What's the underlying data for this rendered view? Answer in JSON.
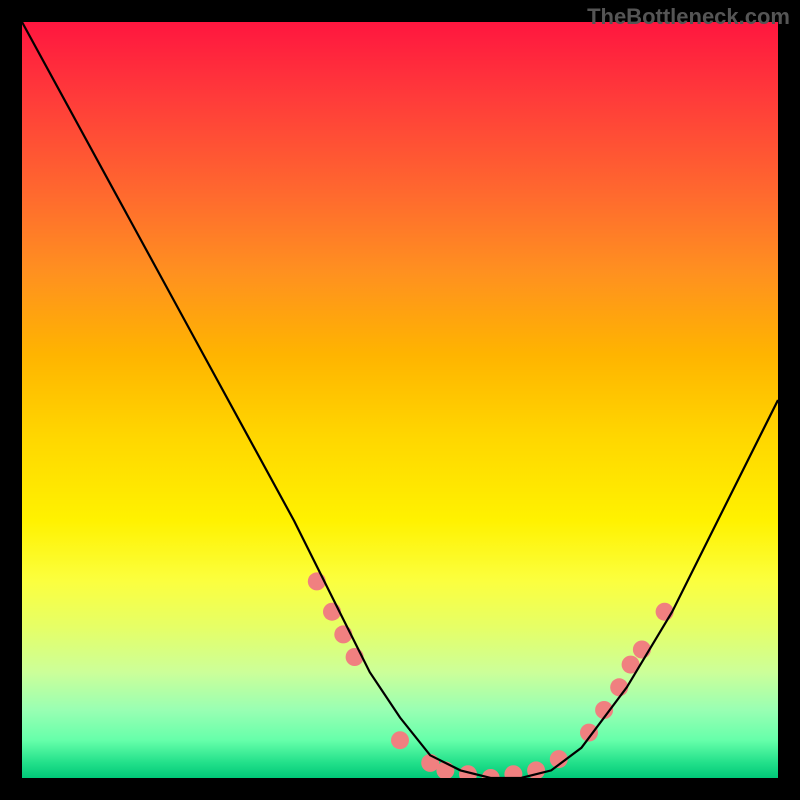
{
  "watermark": "TheBottleneck.com",
  "chart_data": {
    "type": "line",
    "title": "",
    "xlabel": "",
    "ylabel": "",
    "xlim": [
      0,
      100
    ],
    "ylim": [
      0,
      100
    ],
    "grid": false,
    "series": [
      {
        "name": "curve",
        "color": "#000000",
        "x": [
          0,
          6,
          12,
          18,
          24,
          30,
          36,
          42,
          46,
          50,
          54,
          58,
          62,
          66,
          70,
          74,
          80,
          86,
          92,
          100
        ],
        "values": [
          100,
          89,
          78,
          67,
          56,
          45,
          34,
          22,
          14,
          8,
          3,
          1,
          0,
          0,
          1,
          4,
          12,
          22,
          34,
          50
        ]
      }
    ],
    "markers": {
      "name": "dots",
      "color": "#f08080",
      "radius": 9,
      "points": [
        {
          "x": 39,
          "y": 26
        },
        {
          "x": 41,
          "y": 22
        },
        {
          "x": 42.5,
          "y": 19
        },
        {
          "x": 44,
          "y": 16
        },
        {
          "x": 50,
          "y": 5
        },
        {
          "x": 54,
          "y": 2
        },
        {
          "x": 56,
          "y": 1
        },
        {
          "x": 59,
          "y": 0.5
        },
        {
          "x": 62,
          "y": 0
        },
        {
          "x": 65,
          "y": 0.5
        },
        {
          "x": 68,
          "y": 1
        },
        {
          "x": 71,
          "y": 2.5
        },
        {
          "x": 75,
          "y": 6
        },
        {
          "x": 77,
          "y": 9
        },
        {
          "x": 79,
          "y": 12
        },
        {
          "x": 80.5,
          "y": 15
        },
        {
          "x": 82,
          "y": 17
        },
        {
          "x": 85,
          "y": 22
        }
      ]
    },
    "gradient": {
      "stops": [
        {
          "pos": 0,
          "color": "#ff163f"
        },
        {
          "pos": 10,
          "color": "#ff3b3a"
        },
        {
          "pos": 23,
          "color": "#ff6a2e"
        },
        {
          "pos": 33,
          "color": "#ff9020"
        },
        {
          "pos": 44,
          "color": "#ffb400"
        },
        {
          "pos": 55,
          "color": "#ffd700"
        },
        {
          "pos": 66,
          "color": "#fff200"
        },
        {
          "pos": 74,
          "color": "#fbff3f"
        },
        {
          "pos": 80,
          "color": "#e6ff66"
        },
        {
          "pos": 86,
          "color": "#ccff99"
        },
        {
          "pos": 91,
          "color": "#99ffb3"
        },
        {
          "pos": 95,
          "color": "#66ffaa"
        },
        {
          "pos": 98,
          "color": "#22e08a"
        },
        {
          "pos": 100,
          "color": "#00c878"
        }
      ]
    }
  }
}
